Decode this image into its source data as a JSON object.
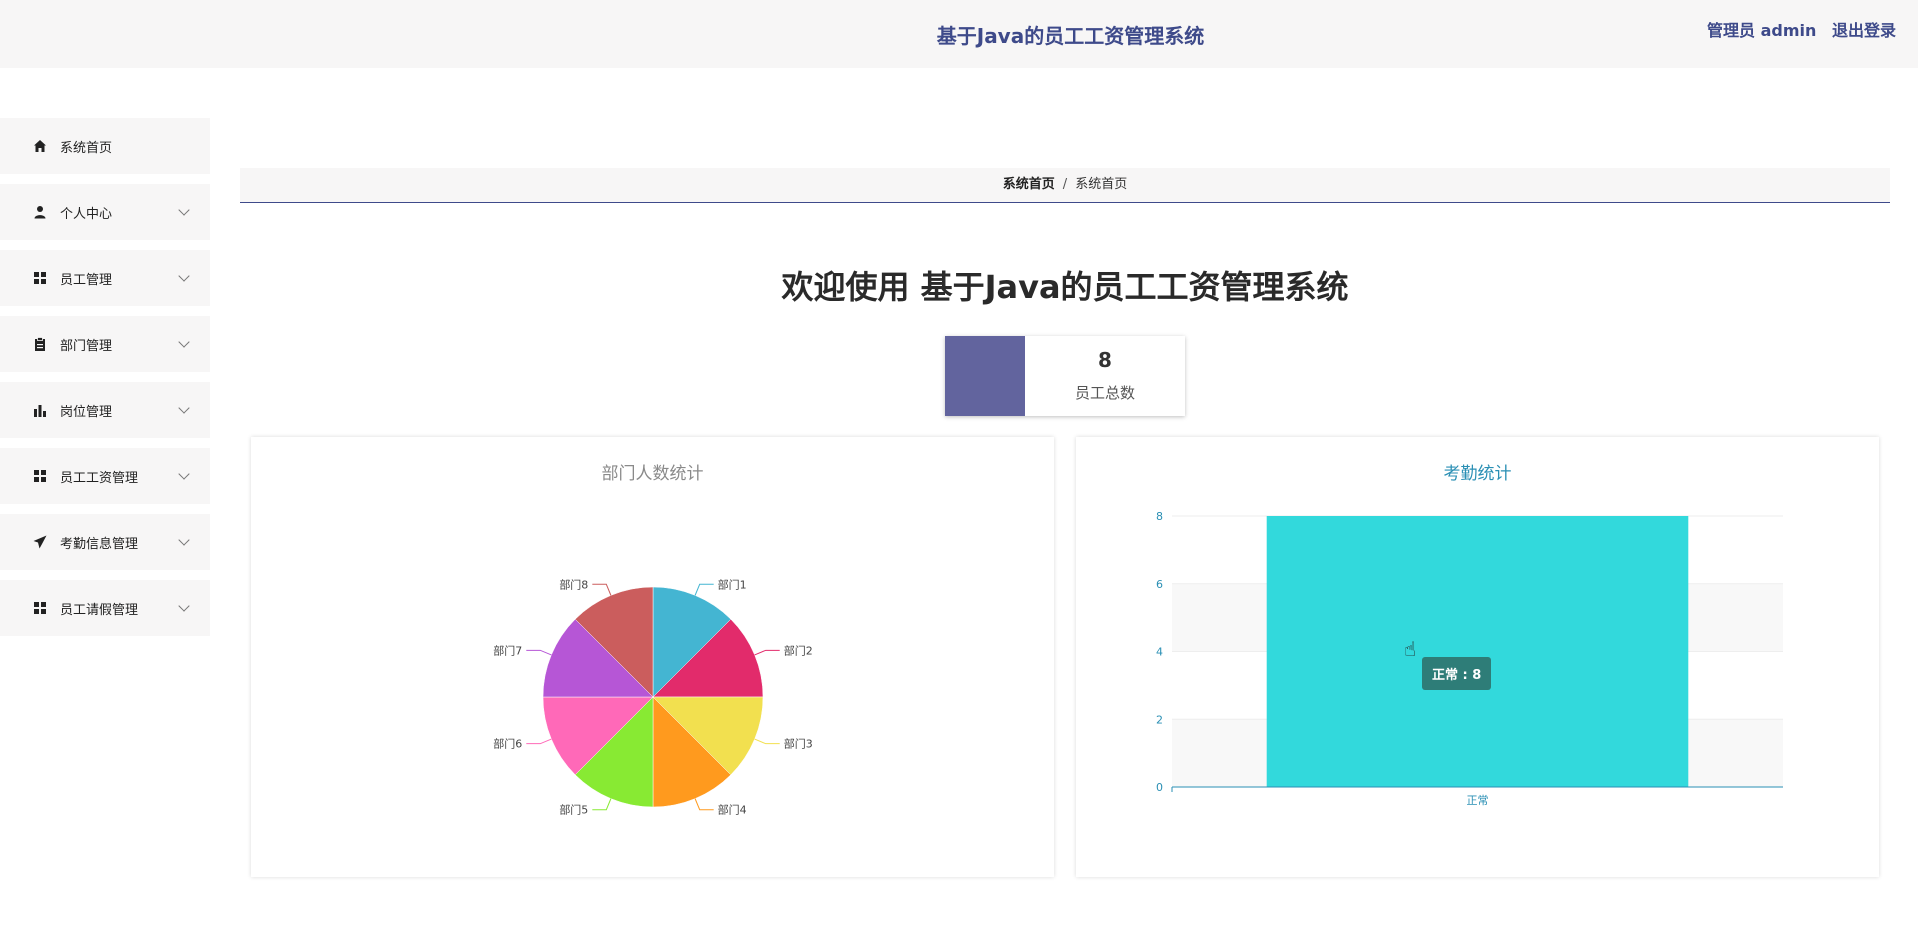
{
  "header": {
    "title": "基于Java的员工工资管理系统",
    "user": "管理员 admin",
    "logout": "退出登录"
  },
  "sidebar": {
    "items": [
      {
        "label": "系统首页",
        "icon": "home-icon"
      },
      {
        "label": "个人中心",
        "icon": "user-icon"
      },
      {
        "label": "员工管理",
        "icon": "grid-icon"
      },
      {
        "label": "部门管理",
        "icon": "clipboard-icon"
      },
      {
        "label": "岗位管理",
        "icon": "bar-chart-icon"
      },
      {
        "label": "员工工资管理",
        "icon": "grid-icon"
      },
      {
        "label": "考勤信息管理",
        "icon": "send-icon"
      },
      {
        "label": "员工请假管理",
        "icon": "grid-icon"
      }
    ]
  },
  "breadcrumb": {
    "level1": "系统首页",
    "separator": "/",
    "level2": "系统首页"
  },
  "welcome": "欢迎使用 基于Java的员工工资管理系统",
  "stat": {
    "value": "8",
    "caption": "员工总数",
    "color": "#62649e"
  },
  "chart_data": [
    {
      "type": "pie",
      "title": "部门人数统计",
      "categories": [
        "部门1",
        "部门2",
        "部门3",
        "部门4",
        "部门5",
        "部门6",
        "部门7",
        "部门8"
      ],
      "values": [
        1,
        1,
        1,
        1,
        1,
        1,
        1,
        1
      ],
      "colors": [
        "#44b5d2",
        "#e22b6b",
        "#f2e04f",
        "#ff9a1e",
        "#88ea33",
        "#ff69b8",
        "#b656d6",
        "#cb5d5d"
      ]
    },
    {
      "type": "bar",
      "title": "考勤统计",
      "categories": [
        "正常"
      ],
      "values": [
        8
      ],
      "ylim": [
        0,
        8
      ],
      "yticks": [
        0,
        2,
        4,
        6,
        8
      ],
      "grid": true,
      "color": "#32d9dc",
      "axis_color": "#2a8fb4",
      "tooltip": "正常 : 8"
    }
  ]
}
